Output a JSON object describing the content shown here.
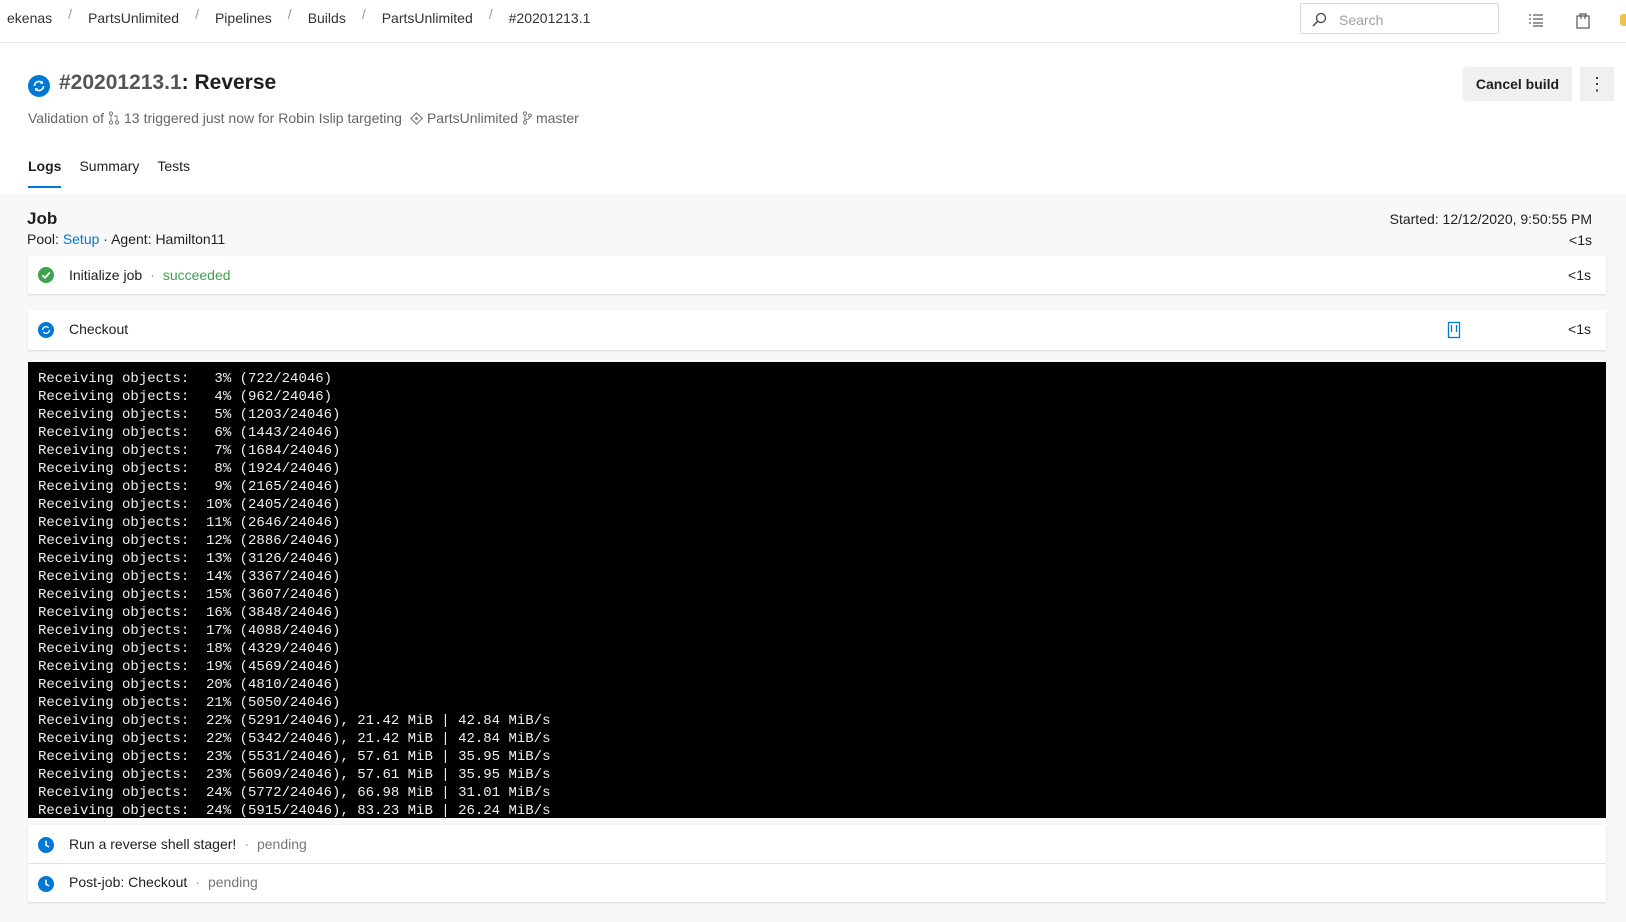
{
  "breadcrumbs": [
    "ekenas",
    "PartsUnlimited",
    "Pipelines",
    "Builds",
    "PartsUnlimited",
    "#20201213.1"
  ],
  "search": {
    "placeholder": "Search"
  },
  "header": {
    "build_number": "#20201213.1",
    "build_name": "Reverse",
    "subtitle": {
      "prefix": "Validation of",
      "pr_number": "13",
      "trigger_text": "triggered just now for Robin Islip targeting",
      "repo": "PartsUnlimited",
      "branch": "master"
    },
    "cancel_label": "Cancel build",
    "more_label": "⋮"
  },
  "tabs": [
    {
      "label": "Logs",
      "active": true
    },
    {
      "label": "Summary",
      "active": false
    },
    {
      "label": "Tests",
      "active": false
    }
  ],
  "job": {
    "title": "Job",
    "pool_label": "Pool:",
    "pool_value": "Setup",
    "agent": "· Agent: Hamilton11",
    "started": "Started: 12/12/2020, 9:50:55 PM",
    "duration": "<1s"
  },
  "steps": [
    {
      "name": "Initialize job",
      "state": "succeeded",
      "duration": "<1s"
    },
    {
      "name": "Checkout",
      "state": "running",
      "duration": "<1s"
    },
    {
      "name": "Run a reverse shell stager!",
      "state": "pending",
      "duration": ""
    },
    {
      "name": "Post-job: Checkout",
      "state": "pending",
      "duration": ""
    }
  ],
  "dot": "·",
  "log_lines": [
    "Receiving objects:   3% (722/24046)",
    "Receiving objects:   4% (962/24046)",
    "Receiving objects:   5% (1203/24046)",
    "Receiving objects:   6% (1443/24046)",
    "Receiving objects:   7% (1684/24046)",
    "Receiving objects:   8% (1924/24046)",
    "Receiving objects:   9% (2165/24046)",
    "Receiving objects:  10% (2405/24046)",
    "Receiving objects:  11% (2646/24046)",
    "Receiving objects:  12% (2886/24046)",
    "Receiving objects:  13% (3126/24046)",
    "Receiving objects:  14% (3367/24046)",
    "Receiving objects:  15% (3607/24046)",
    "Receiving objects:  16% (3848/24046)",
    "Receiving objects:  17% (4088/24046)",
    "Receiving objects:  18% (4329/24046)",
    "Receiving objects:  19% (4569/24046)",
    "Receiving objects:  20% (4810/24046)",
    "Receiving objects:  21% (5050/24046)",
    "Receiving objects:  22% (5291/24046), 21.42 MiB | 42.84 MiB/s",
    "Receiving objects:  22% (5342/24046), 21.42 MiB | 42.84 MiB/s",
    "Receiving objects:  23% (5531/24046), 57.61 MiB | 35.95 MiB/s",
    "Receiving objects:  23% (5609/24046), 57.61 MiB | 35.95 MiB/s",
    "Receiving objects:  24% (5772/24046), 66.98 MiB | 31.01 MiB/s",
    "Receiving objects:  24% (5915/24046), 83.23 MiB | 26.24 MiB/s"
  ],
  "colors": {
    "accent": "#0078d4",
    "succeeded": "#3fa34d",
    "running": "#0078d4",
    "pending": "#0078d4"
  }
}
